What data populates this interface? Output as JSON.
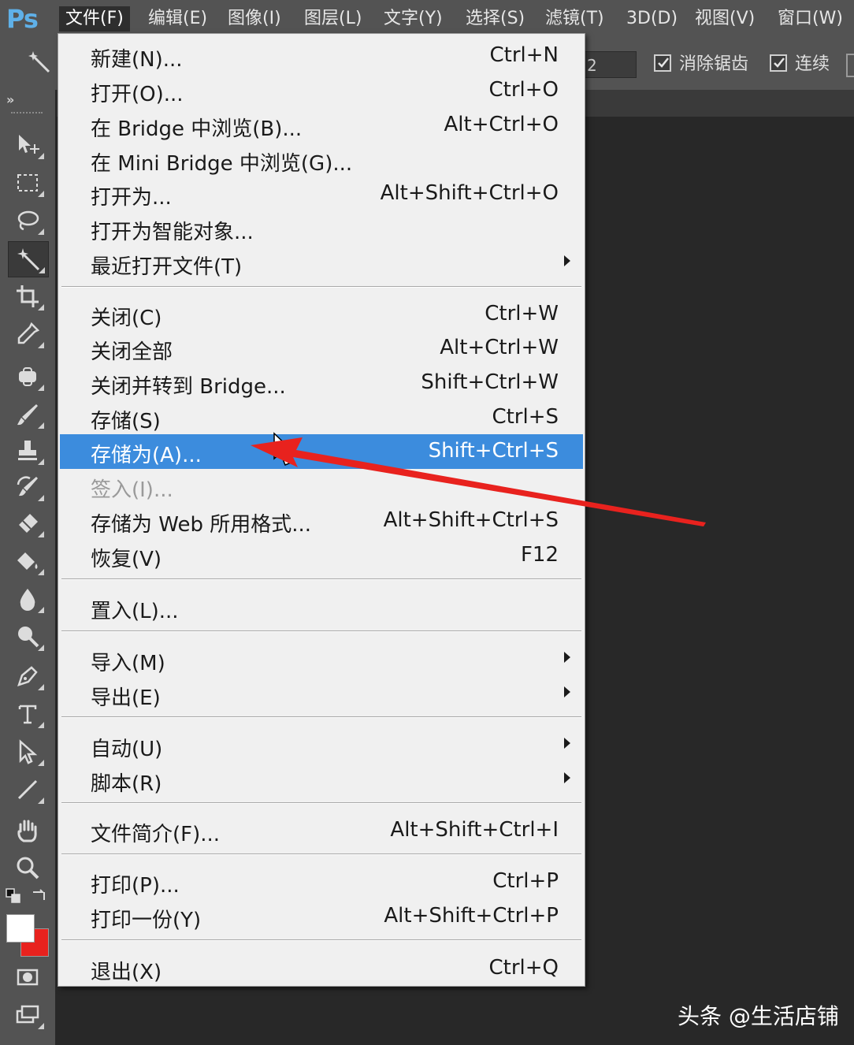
{
  "app": {
    "logo": "Ps"
  },
  "menubar": {
    "items": [
      {
        "label": "文件(F)"
      },
      {
        "label": "编辑(E)"
      },
      {
        "label": "图像(I)"
      },
      {
        "label": "图层(L)"
      },
      {
        "label": "文字(Y)"
      },
      {
        "label": "选择(S)"
      },
      {
        "label": "滤镜(T)"
      },
      {
        "label": "3D(D)"
      },
      {
        "label": "视图(V)"
      },
      {
        "label": "窗口(W)"
      }
    ]
  },
  "options": {
    "field_value": "2",
    "antialias_label": "消除锯齿",
    "contiguous_label": "连续"
  },
  "toolbox": {
    "collapse": "»"
  },
  "file_menu": {
    "items": [
      {
        "label": "新建(N)...",
        "shortcut": "Ctrl+N"
      },
      {
        "label": "打开(O)...",
        "shortcut": "Ctrl+O"
      },
      {
        "label": "在 Bridge 中浏览(B)...",
        "shortcut": "Alt+Ctrl+O"
      },
      {
        "label": "在 Mini Bridge 中浏览(G)...",
        "shortcut": ""
      },
      {
        "label": "打开为...",
        "shortcut": "Alt+Shift+Ctrl+O"
      },
      {
        "label": "打开为智能对象...",
        "shortcut": ""
      },
      {
        "label": "最近打开文件(T)",
        "shortcut": ""
      },
      {
        "label": "关闭(C)",
        "shortcut": "Ctrl+W"
      },
      {
        "label": "关闭全部",
        "shortcut": "Alt+Ctrl+W"
      },
      {
        "label": "关闭并转到 Bridge...",
        "shortcut": "Shift+Ctrl+W"
      },
      {
        "label": "存储(S)",
        "shortcut": "Ctrl+S"
      },
      {
        "label": "存储为(A)...",
        "shortcut": "Shift+Ctrl+S"
      },
      {
        "label": "签入(I)...",
        "shortcut": ""
      },
      {
        "label": "存储为 Web 所用格式...",
        "shortcut": "Alt+Shift+Ctrl+S"
      },
      {
        "label": "恢复(V)",
        "shortcut": "F12"
      },
      {
        "label": "置入(L)...",
        "shortcut": ""
      },
      {
        "label": "导入(M)",
        "shortcut": ""
      },
      {
        "label": "导出(E)",
        "shortcut": ""
      },
      {
        "label": "自动(U)",
        "shortcut": ""
      },
      {
        "label": "脚本(R)",
        "shortcut": ""
      },
      {
        "label": "文件简介(F)...",
        "shortcut": "Alt+Shift+Ctrl+I"
      },
      {
        "label": "打印(P)...",
        "shortcut": "Ctrl+P"
      },
      {
        "label": "打印一份(Y)",
        "shortcut": "Alt+Shift+Ctrl+P"
      },
      {
        "label": "退出(X)",
        "shortcut": "Ctrl+Q"
      }
    ]
  },
  "colors": {
    "highlight": "#3c8cdd",
    "annotation_arrow": "#e8221e",
    "foreground": "#ffffff",
    "background": "#e8221e"
  },
  "watermark": {
    "text": "头条 @生活店铺"
  }
}
